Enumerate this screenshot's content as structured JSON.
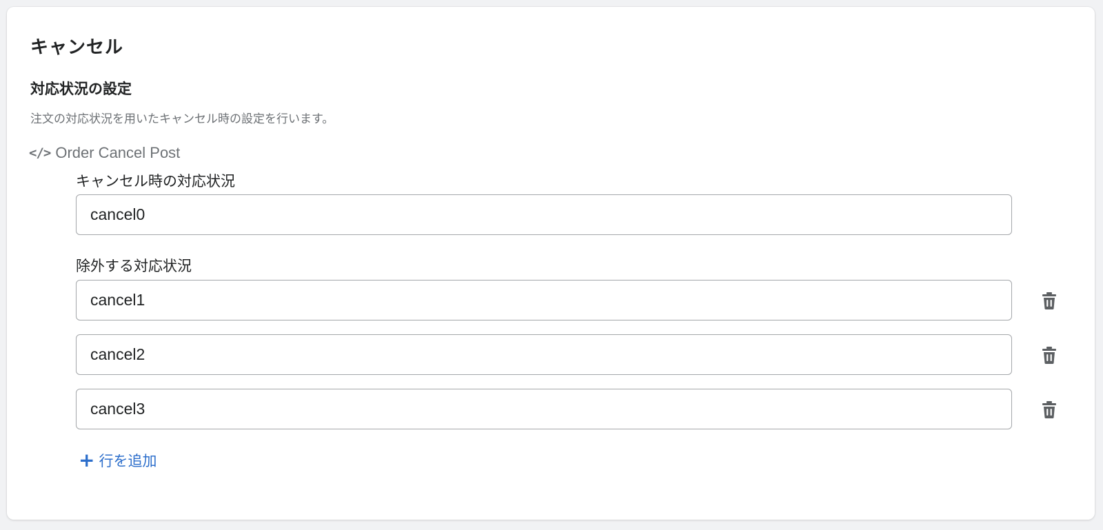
{
  "card": {
    "title": "キャンセル"
  },
  "section": {
    "title": "対応状況の設定",
    "description": "注文の対応状況を用いたキャンセル時の設定を行います。",
    "code_label": "Order Cancel Post",
    "code_icon": "</>"
  },
  "cancel_status": {
    "label": "キャンセル時の対応状況",
    "value": "cancel0"
  },
  "excluded_statuses": {
    "label": "除外する対応状況",
    "rows": [
      {
        "value": "cancel1"
      },
      {
        "value": "cancel2"
      },
      {
        "value": "cancel3"
      }
    ]
  },
  "add_row": {
    "icon": "+",
    "label": "行を追加"
  },
  "colors": {
    "accent": "#2c6ecb",
    "muted": "#6d7175",
    "border": "#a3a6a9"
  },
  "icons": {
    "delete": "trash-icon",
    "code": "code-icon",
    "add": "plus-icon"
  }
}
